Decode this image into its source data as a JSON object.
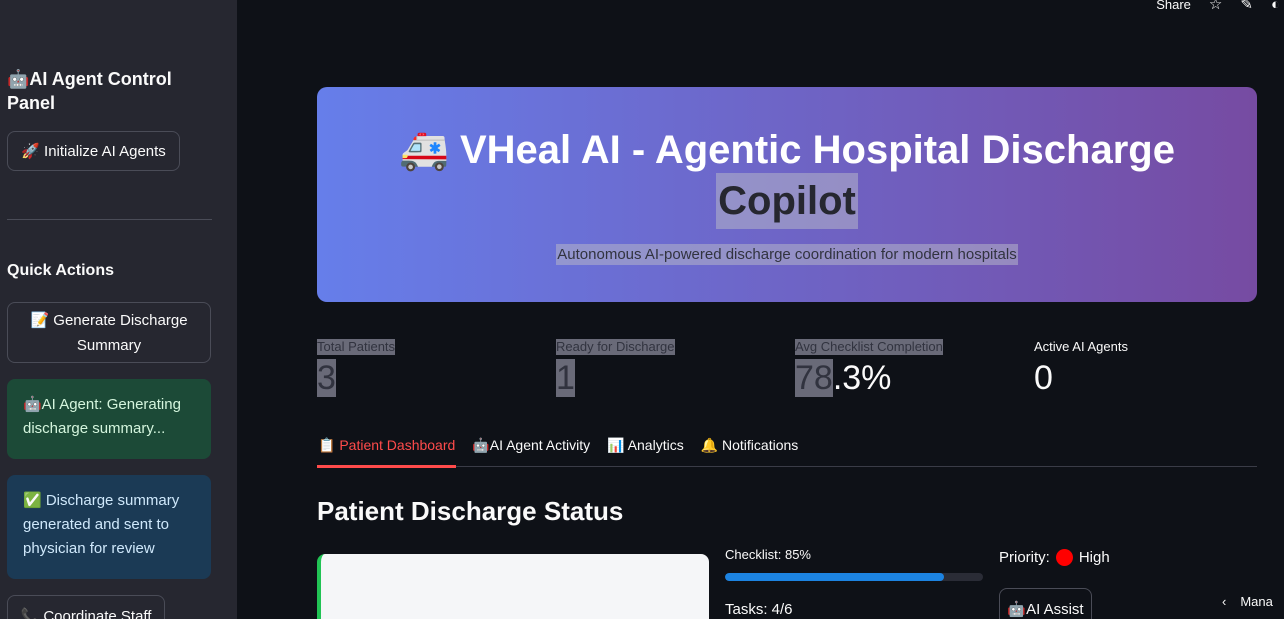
{
  "topbar": {
    "share": "Share",
    "star_icon": "☆",
    "edit_icon": "✎",
    "github_icon": "◐"
  },
  "sidebar": {
    "title": "🤖AI Agent Control Panel",
    "init_button": "🚀 Initialize AI Agents",
    "quick_actions": "Quick Actions",
    "generate_button": "📝 Generate Discharge Summary",
    "alert_info": "🤖AI Agent: Generating discharge summary...",
    "alert_success": "✅ Discharge summary generated and sent to physician for review",
    "coordinate_button": "📞 Coordinate Staff"
  },
  "header": {
    "title_line1": "🚑 VHeal AI - Agentic Hospital Discharge",
    "title_line2": "Copilot",
    "subtitle": "Autonomous AI-powered discharge coordination for modern hospitals"
  },
  "metrics": [
    {
      "label": "Total Patients",
      "value": "3"
    },
    {
      "label": "Ready for Discharge",
      "value": "1"
    },
    {
      "label": "Avg Checklist Completion",
      "value_hl": "78",
      "value_rest": ".3%"
    },
    {
      "label": "Active AI Agents",
      "value": "0"
    }
  ],
  "tabs": [
    "📋 Patient Dashboard",
    "🤖AI Agent Activity",
    "📊 Analytics",
    "🔔 Notifications"
  ],
  "section_title": "Patient Discharge Status",
  "patient": {
    "checklist_label": "Checklist: 85%",
    "checklist_progress": 0.85,
    "tasks": "Tasks: 4/6",
    "priority_label": "Priority:",
    "priority_value": "High",
    "assist_button": "🤖AI Assist"
  },
  "manage": {
    "chevron": "‹",
    "label": "Mana"
  },
  "colors": {
    "accent": "#ff4b4b",
    "progress": "#1c83e1",
    "banner_start": "#667eea",
    "banner_end": "#764ba2"
  }
}
